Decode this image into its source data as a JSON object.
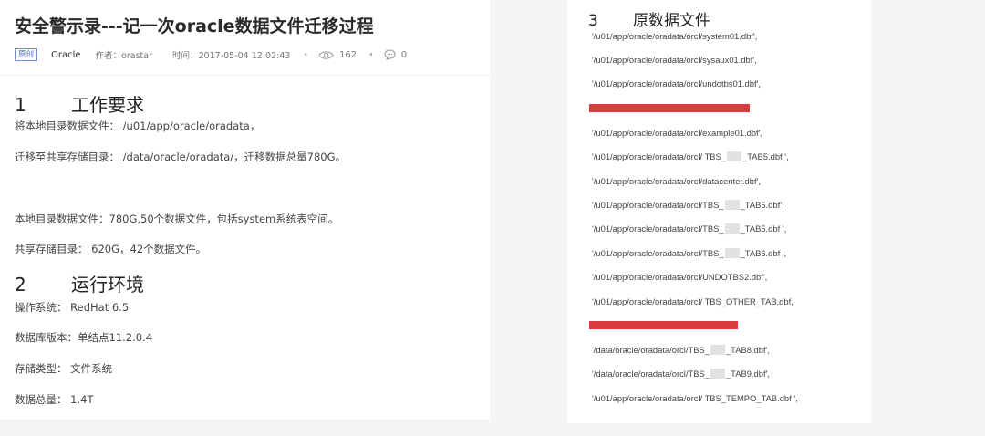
{
  "article": {
    "title": "安全警示录---记一次oracle数据文件迁移过程",
    "badge": "原创",
    "category": "Oracle",
    "author": "作者：orastar",
    "time": "时间：2017-05-04 12:02:43",
    "views": "162",
    "comments": "0"
  },
  "section1": {
    "num": "1",
    "title": "工作要求",
    "lines": [
      "将本地目录数据文件：  /u01/app/oracle/oradata，",
      "迁移至共享存储目录：  /data/oracle/oradata/，迁移数据总量780G。",
      "本地目录数据文件：780G,50个数据文件，包括system系统表空间。",
      "共享存储目录：  620G，42个数据文件。"
    ]
  },
  "section2": {
    "num": "2",
    "title": "运行环境",
    "lines": [
      "操作系统：  RedHat 6.5",
      "数据库版本：单结点11.2.0.4",
      "存储类型：  文件系统",
      "数据总量：  1.4T"
    ]
  },
  "section3": {
    "num": "3",
    "title": "原数据文件",
    "paths": [
      "'/u01/app/oracle/oradata/orcl/system01.dbf',",
      "'/u01/app/oracle/oradata/orcl/sysaux01.dbf',",
      "'/u01/app/oracle/oradata/orcl/undotbs01.dbf',",
      "'/u01/app/oracle/oradata/orcl/example01.dbf',",
      {
        "pre": "'/u01/app/oracle/oradata/orcl/ TBS_",
        "post": "_TAB5.dbf ',",
        "masked": true
      },
      "'/u01/app/oracle/oradata/orcl/datacenter.dbf',",
      {
        "pre": "'/u01/app/oracle/oradata/orcl/TBS_",
        "post": "_TAB5.dbf',",
        "masked": true
      },
      {
        "pre": "'/u01/app/oracle/oradata/orcl/TBS_",
        "post": "_TAB5.dbf ',",
        "masked": true
      },
      {
        "pre": "'/u01/app/oracle/oradata/orcl/TBS_",
        "post": "_TAB6.dbf ',",
        "masked": true
      },
      "'/u01/app/oracle/oradata/orcl/UNDOTBS2.dbf',",
      "'/u01/app/oracle/oradata/orcl/ TBS_OTHER_TAB.dbf,",
      {
        "pre": "'/data/oracle/oradata/orcl/TBS_",
        "post": "_TAB8.dbf',",
        "masked": true
      },
      {
        "pre": "'/data/oracle/oradata/orcl/TBS_",
        "post": "_TAB9.dbf',",
        "masked": true
      },
      "'/u01/app/oracle/oradata/orcl/ TBS_TEMPO_TAB.dbf ',"
    ]
  },
  "colors": {
    "highlight": "#d83c3c",
    "badge": "#4f6fc5"
  }
}
